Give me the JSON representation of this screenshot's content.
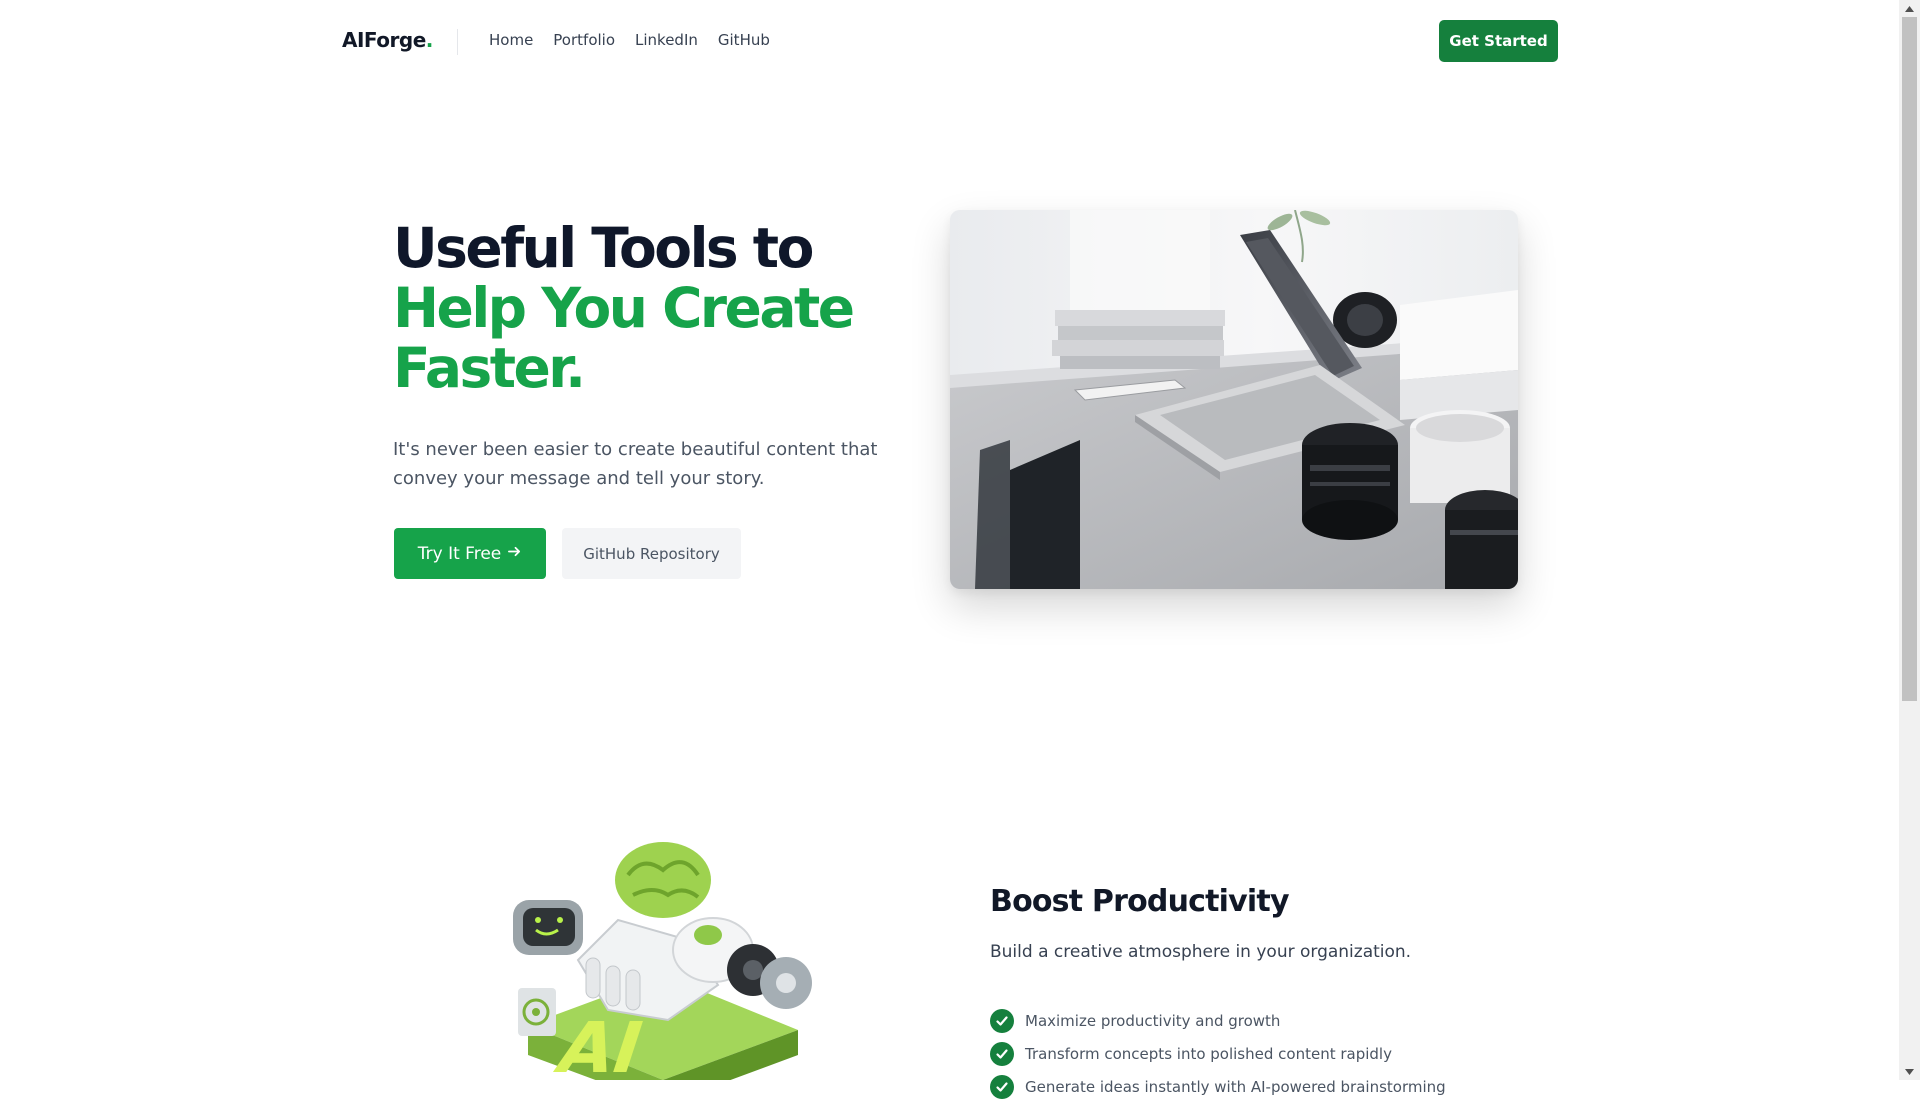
{
  "nav": {
    "brand": "AIForge",
    "brand_dot": ".",
    "links": [
      "Home",
      "Portfolio",
      "LinkedIn",
      "GitHub"
    ],
    "cta": "Get Started"
  },
  "hero": {
    "title_line1": "Useful Tools to",
    "title_line2": "Help You Create",
    "title_line3": "Faster.",
    "subtitle": "It's never been easier to create beautiful content that convey your message and tell your story.",
    "primary_button": "Try It Free",
    "primary_button_icon": "arrow-right-icon",
    "secondary_button": "GitHub Repository"
  },
  "feature": {
    "title": "Boost Productivity",
    "subtitle": "Build a creative atmosphere in your organization.",
    "items": [
      "Maximize productivity and growth",
      "Transform concepts into polished content rapidly",
      "Generate ideas instantly with AI-powered brainstorming"
    ]
  },
  "colors": {
    "accent": "#16a34a",
    "accent_dark": "#15803d",
    "heading": "#0f172a"
  }
}
